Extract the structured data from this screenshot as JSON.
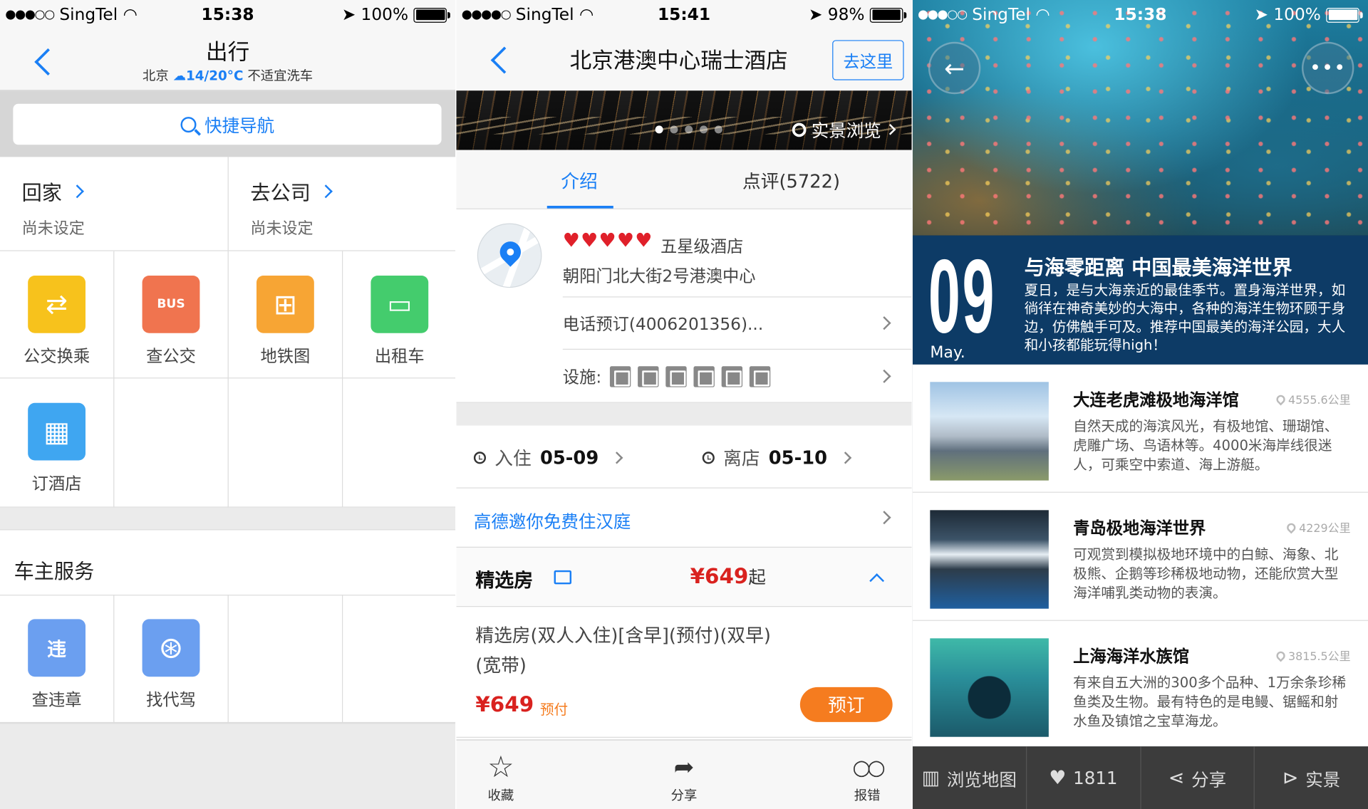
{
  "screen1": {
    "status": {
      "carrier": "SingTel",
      "time": "15:38",
      "battery": "100%",
      "battery_level": 1.0
    },
    "title": "出行",
    "weather": {
      "city": "北京",
      "temp": "14/20°C",
      "advice": "不适宜洗车"
    },
    "search_label": "快捷导航",
    "quick": [
      {
        "label": "回家",
        "sub": "尚未设定"
      },
      {
        "label": "去公司",
        "sub": "尚未设定"
      }
    ],
    "services": [
      {
        "label": "公交换乘",
        "color": "#f7c21c",
        "icon": "bus-transfer-icon",
        "glyph": "⇄"
      },
      {
        "label": "查公交",
        "color": "#f0744f",
        "icon": "bus-search-icon",
        "glyph": "BUS"
      },
      {
        "label": "地铁图",
        "color": "#f7a534",
        "icon": "subway-map-icon",
        "glyph": "⊞"
      },
      {
        "label": "出租车",
        "color": "#44cc6d",
        "icon": "taxi-icon",
        "glyph": "🚕"
      },
      {
        "label": "订酒店",
        "color": "#3fa6f1",
        "icon": "hotel-icon",
        "glyph": "▦"
      }
    ],
    "owner_title": "车主服务",
    "owner_services": [
      {
        "label": "查违章",
        "color": "#6b9ff0",
        "icon": "violation-icon",
        "glyph": "违"
      },
      {
        "label": "找代驾",
        "color": "#6b9ff0",
        "icon": "steering-wheel-icon",
        "glyph": "⊛"
      }
    ]
  },
  "screen2": {
    "status": {
      "carrier": "SingTel",
      "time": "15:41",
      "battery": "98%",
      "battery_level": 0.98
    },
    "title": "北京港澳中心瑞士酒店",
    "goto_label": "去这里",
    "street_view": "实景浏览",
    "tabs": [
      "介绍",
      "点评(5722)"
    ],
    "hearts": "♥♥♥♥♥",
    "level": "五星级酒店",
    "address": "朝阳门北大街2号港澳中心",
    "phone": "电话预订(4006201356)...",
    "facilities_label": "设施:",
    "checkin_label": "入住",
    "checkin_date": "05-09",
    "checkout_label": "离店",
    "checkout_date": "05-10",
    "promo": "高德邀你免费住汉庭",
    "room_type": "精选房",
    "room_type_price": "¥649",
    "room_type_price_suffix": "起",
    "room_desc": "精选房(双人入住)[含早](预付)(双早)(宽带)",
    "room_price": "¥649",
    "prepay": "预付",
    "book": "预订",
    "bottom": [
      {
        "label": "收藏",
        "icon": "star-icon",
        "glyph": "☆"
      },
      {
        "label": "分享",
        "icon": "share-icon",
        "glyph": "➦"
      },
      {
        "label": "报错",
        "icon": "report-icon",
        "glyph": "○○"
      }
    ]
  },
  "screen3": {
    "status": {
      "carrier": "SingTel",
      "time": "15:38",
      "battery": "100%",
      "battery_level": 1.0
    },
    "day": "09",
    "month": "May.",
    "banner_title": "与海零距离 中国最美海洋世界",
    "banner_text": "夏日，是与大海亲近的最佳季节。置身海洋世界，如徜徉在神奇美妙的大海中，各种的海洋生物环顾于身边，仿佛触手可及。推荐中国最美的海洋公园，大人和小孩都能玩得high！",
    "items": [
      {
        "name": "大连老虎滩极地海洋馆",
        "dist": "4555.6公里",
        "desc": "自然天成的海滨风光，有极地馆、珊瑚馆、虎雕广场、鸟语林等。4000米海岸线很迷人，可乘空中索道、海上游艇。"
      },
      {
        "name": "青岛极地海洋世界",
        "dist": "4229公里",
        "desc": "可观赏到模拟极地环境中的白鲸、海象、北极熊、企鹅等珍稀极地动物，还能欣赏大型海洋哺乳类动物的表演。"
      },
      {
        "name": "上海海洋水族馆",
        "dist": "3815.5公里",
        "desc": "有来自五大洲的300多个品种、1万余条珍稀鱼类及生物。最有特色的是电鳗、锯鳐和射水鱼及镇馆之宝草海龙。"
      }
    ],
    "bar": [
      {
        "label": "浏览地图",
        "icon": "map-icon",
        "glyph": "▥"
      },
      {
        "label": "1811",
        "icon": "heart-icon",
        "glyph": "♥"
      },
      {
        "label": "分享",
        "icon": "share-icon",
        "glyph": "⋖"
      },
      {
        "label": "实景",
        "icon": "street-view-icon",
        "glyph": "⊳"
      }
    ]
  }
}
